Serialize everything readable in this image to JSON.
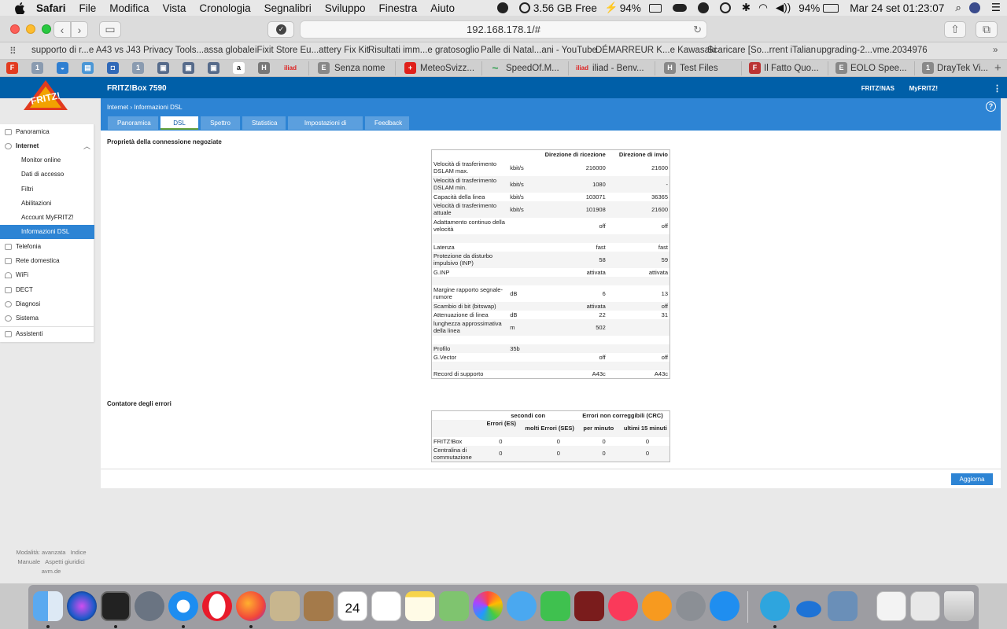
{
  "menubar": {
    "app": "Safari",
    "items": [
      "File",
      "Modifica",
      "Vista",
      "Cronologia",
      "Segnalibri",
      "Sviluppo",
      "Finestra",
      "Aiuto"
    ],
    "memory": "3.56 GB Free",
    "cpu_percent": "94%",
    "battery_percent": "94%",
    "clock": "Mar 24 set  01:23:07"
  },
  "safari": {
    "url": "192.168.178.1/#",
    "favorites": [
      "supporto di r...e A43 vs J43",
      "Privacy Tools...assa globale",
      "iFixit Store Eu...attery Fix Kit",
      "Risultati imm...e gratosoglio",
      "Palle di Natal...ani - YouTube",
      "DÉMARREUR K...e Kawasaki",
      "Scaricare [So...rrent iTalian",
      "upgrading-2...vme.2034976"
    ],
    "tabs": {
      "icon_labels": [
        "1",
        "1",
        "H",
        "a",
        "H"
      ],
      "titled": [
        "Senza nome",
        "MeteoSvizz...",
        "SpeedOf.M...",
        "iliad - Benv...",
        "Test Files",
        "Il Fatto Quo...",
        "EOLO Spee...",
        "DrayTek Vi..."
      ],
      "titled_icons": [
        "E",
        "+",
        "~",
        "iliad",
        "H",
        "F",
        "E",
        "1"
      ],
      "new_tab": "+"
    }
  },
  "fritz": {
    "brand": "FRITZ!",
    "device": "FRITZ!Box 7590",
    "header_links": [
      "FRITZ!NAS",
      "MyFRITZ!"
    ],
    "menu_glyph": "⋮",
    "help_glyph": "?",
    "breadcrumb": [
      "Internet",
      "Informazioni DSL"
    ],
    "breadcrumb_sep": "›",
    "tabs": [
      "Panoramica",
      "DSL",
      "Spettro",
      "Statistica",
      "Impostazioni di linea",
      "Feedback"
    ],
    "active_tab": "DSL",
    "sidebar": [
      {
        "label": "Panoramica",
        "level": 0,
        "icon": "home-icon"
      },
      {
        "label": "Internet",
        "level": 0,
        "icon": "globe-icon",
        "expanded": true
      },
      {
        "label": "Monitor online",
        "level": 1
      },
      {
        "label": "Dati di accesso",
        "level": 1
      },
      {
        "label": "Filtri",
        "level": 1
      },
      {
        "label": "Abilitazioni",
        "level": 1
      },
      {
        "label": "Account MyFRITZ!",
        "level": 1
      },
      {
        "label": "Informazioni DSL",
        "level": 1,
        "active": true
      },
      {
        "label": "Telefonia",
        "level": 0,
        "icon": "phone-icon"
      },
      {
        "label": "Rete domestica",
        "level": 0,
        "icon": "network-icon"
      },
      {
        "label": "WiFi",
        "level": 0,
        "icon": "wifi-icon"
      },
      {
        "label": "DECT",
        "level": 0,
        "icon": "dect-icon"
      },
      {
        "label": "Diagnosi",
        "level": 0,
        "icon": "diagnosis-icon"
      },
      {
        "label": "Sistema",
        "level": 0,
        "icon": "system-icon"
      },
      {
        "label": "Assistenti",
        "level": 0,
        "icon": "wizard-icon"
      }
    ],
    "section1_title": "Proprietà della connessione negoziate",
    "props_headers": [
      "",
      "",
      "Direzione di ricezione",
      "Direzione di invio"
    ],
    "props_rows": [
      [
        "Velocità di trasferimento DSLAM max.",
        "kbit/s",
        "216000",
        "21600"
      ],
      [
        "Velocità di trasferimento DSLAM min.",
        "kbit/s",
        "1080",
        "-"
      ],
      [
        "Capacità della linea",
        "kbit/s",
        "103071",
        "36365"
      ],
      [
        "Velocità di trasferimento attuale",
        "kbit/s",
        "101908",
        "21600"
      ],
      [
        "Adattamento continuo della velocità",
        "",
        "off",
        "off"
      ],
      [
        "",
        "",
        "",
        ""
      ],
      [
        "Latenza",
        "",
        "fast",
        "fast"
      ],
      [
        "Protezione da disturbo impulsivo (INP)",
        "",
        "58",
        "59"
      ],
      [
        "G.INP",
        "",
        "attivata",
        "attivata"
      ],
      [
        "",
        "",
        "",
        ""
      ],
      [
        "Margine rapporto segnale-rumore",
        "dB",
        "6",
        "13"
      ],
      [
        "Scambio di bit (bitswap)",
        "",
        "attivata",
        "off"
      ],
      [
        "Attenuazione di linea",
        "dB",
        "22",
        "31"
      ],
      [
        "lunghezza approssimativa della linea",
        "m",
        "502",
        ""
      ],
      [
        "",
        "",
        "",
        ""
      ],
      [
        "Profilo",
        "35b",
        "",
        ""
      ],
      [
        "G.Vector",
        "",
        "off",
        "off"
      ],
      [
        "",
        "",
        "",
        ""
      ],
      [
        "Record di supporto",
        "",
        "A43c",
        "A43c"
      ]
    ],
    "section2_title": "Contatore degli errori",
    "errors_group_headers": [
      "",
      "secondi con",
      "Errori non correggibili (CRC)"
    ],
    "errors_headers": [
      "",
      "Errori (ES)",
      "molti Errori (SES)",
      "per minuto",
      "ultimi 15 minuti"
    ],
    "errors_rows": [
      [
        "FRITZ!Box",
        "0",
        "0",
        "0",
        "0"
      ],
      [
        "Centralina di commutazione",
        "0",
        "0",
        "0",
        "0"
      ]
    ],
    "refresh_button": "Aggiorna",
    "footer_links": [
      "Modalità: avanzata",
      "Indice",
      "Manuale",
      "Aspetti giuridici",
      "avm.de"
    ]
  },
  "dock": {
    "calendar_day": "24",
    "calendar_month": "SET"
  },
  "colors": {
    "fritz_blue": "#005fa8",
    "fritz_accent": "#2d84d4",
    "tab_inactive": "#5b9fde"
  }
}
